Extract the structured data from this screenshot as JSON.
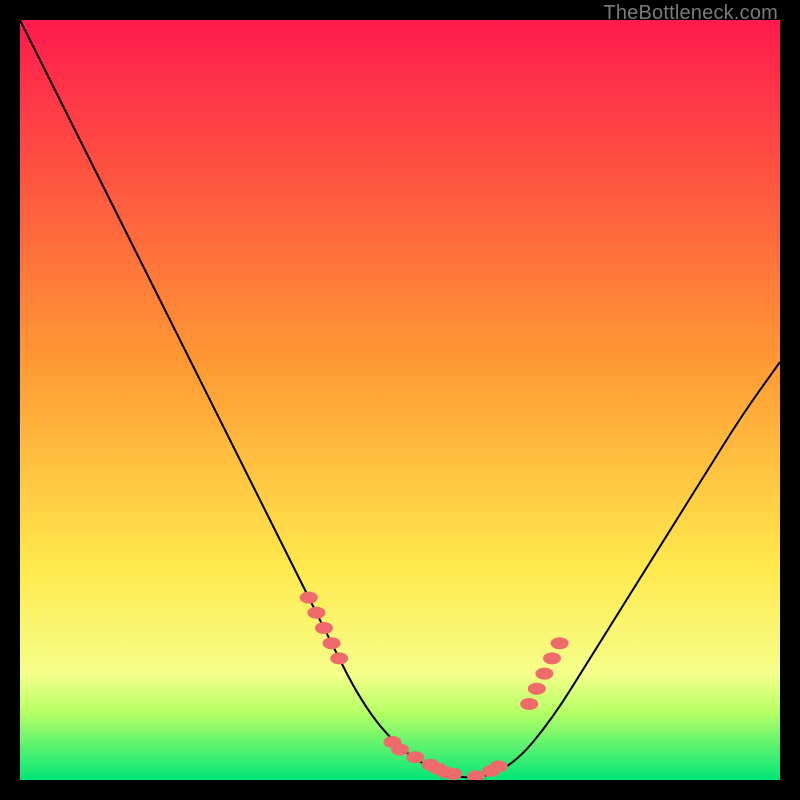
{
  "watermark": "TheBottleneck.com",
  "chart_data": {
    "type": "line",
    "title": "",
    "xlabel": "",
    "ylabel": "",
    "xlim": [
      0,
      100
    ],
    "ylim": [
      0,
      100
    ],
    "background_gradient": {
      "top": "#ff1a4d",
      "mid": "#ffcc33",
      "bottom_band": "#b8ff66",
      "bottom_edge": "#00e676"
    },
    "series": [
      {
        "name": "bottleneck-curve",
        "x": [
          0,
          5,
          10,
          15,
          20,
          25,
          30,
          35,
          40,
          45,
          50,
          55,
          60,
          65,
          70,
          75,
          80,
          85,
          90,
          95,
          100
        ],
        "y": [
          100,
          90,
          80,
          70,
          60,
          50,
          40,
          30,
          20,
          10,
          4,
          1,
          0,
          2,
          8,
          16,
          24,
          32,
          40,
          48,
          55
        ]
      }
    ],
    "markers": {
      "name": "highlight-points",
      "color": "#ef6b6b",
      "x": [
        38,
        39,
        40,
        41,
        42,
        49,
        50,
        52,
        54,
        55,
        56,
        57,
        60,
        62,
        63,
        67,
        68,
        69,
        70,
        71
      ],
      "y": [
        24,
        22,
        20,
        18,
        16,
        5,
        4,
        3,
        2,
        1.5,
        1,
        0.8,
        0.5,
        1.2,
        1.8,
        10,
        12,
        14,
        16,
        18
      ]
    }
  }
}
